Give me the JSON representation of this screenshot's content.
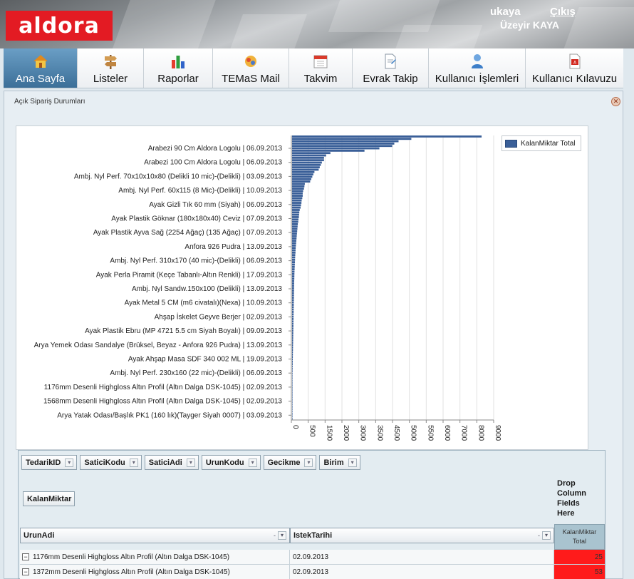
{
  "header": {
    "logo_text": "aldora",
    "username": "ukaya",
    "logout_label": "Çıkış",
    "full_name": "Üzeyir KAYA"
  },
  "nav": {
    "items": [
      {
        "label": "Ana Sayfa",
        "icon": "home-icon",
        "active": true
      },
      {
        "label": "Listeler",
        "icon": "signpost-icon",
        "active": false
      },
      {
        "label": "Raporlar",
        "icon": "bar-chart-icon",
        "active": false
      },
      {
        "label": "TEMaS Mail",
        "icon": "mail-icon",
        "active": false
      },
      {
        "label": "Takvim",
        "icon": "calendar-icon",
        "active": false
      },
      {
        "label": "Evrak Takip",
        "icon": "document-icon",
        "active": false
      },
      {
        "label": "Kullanıcı İşlemleri",
        "icon": "user-icon",
        "active": false
      },
      {
        "label": "Kullanıcı Kılavuzu",
        "icon": "pdf-icon",
        "active": false
      }
    ]
  },
  "panel": {
    "title": "Açık Sipariş Durumları"
  },
  "chart_data": {
    "type": "bar",
    "orientation": "horizontal",
    "legend": {
      "entries": [
        "KalanMiktar Total"
      ],
      "placement": "top-right"
    },
    "series_color": "#3a5f98",
    "x_ticks": [
      "0",
      "500",
      "1500",
      "2000",
      "3000",
      "3500",
      "4500",
      "5000",
      "5500",
      "6000",
      "7000",
      "8000",
      "9000"
    ],
    "xlim": [
      0,
      9500
    ],
    "grid": true,
    "category_labels": [
      "Arabezi 90 Cm Aldora Logolu | 06.09.2013",
      "Arabezi 100 Cm Aldora Logolu | 06.09.2013",
      "Ambj. Nyl Perf. 70x10x10x80 (Delikli 10 mic)-(Delikli) | 03.09.2013",
      "Ambj. Nyl Perf. 60x115 (8 Mic)-(Delikli) | 10.09.2013",
      "Ayak Gizli Tık 60 mm (Siyah) | 06.09.2013",
      "Ayak Plastik Göknar (180x180x40) Ceviz | 07.09.2013",
      "Ayak Plastik Ayva Sağ (2254 Ağaç) (135 Ağaç) | 07.09.2013",
      "Anfora 926 Pudra | 13.09.2013",
      "Ambj. Nyl Perf. 310x170 (40 mic)-(Delikli) | 06.09.2013",
      "Ayak Perla Piramit (Keçe Tabanlı-Altın Renkli) | 17.09.2013",
      "Ambj. Nyl Sandw.150x100 (Delikli) | 13.09.2013",
      "Ayak Metal 5 CM (m6 civatalı)(Nexa) | 10.09.2013",
      "Ahşap İskelet Geyve Berjer | 02.09.2013",
      "Ayak Plastik Ebru (MP 4721 5.5 cm Siyah Boyalı) | 09.09.2013",
      "Arya Yemek Odası Sandalye (Brüksel, Beyaz - Anfora 926 Pudra) | 13.09.2013",
      "Ayak Ahşap Masa SDF 340 002 ML | 19.09.2013",
      "Ambj. Nyl Perf. 230x160 (22 mic)-(Delikli) | 06.09.2013",
      "1176mm Desenli Highgloss Altın Profil (Altın Dalga DSK-1045)  | 02.09.2013",
      "1568mm Desenli Highgloss Altın Profil (Altın Dalga DSK-1045)  | 02.09.2013",
      "Arya Yatak Odası/Başlık PK1 (160 lık)(Tayger Siyah 0007) | 03.09.2013"
    ],
    "values": [
      8900,
      5600,
      5000,
      4800,
      4700,
      4100,
      3400,
      1800,
      1600,
      1500,
      1500,
      1400,
      1350,
      1300,
      1250,
      1050,
      1000,
      950,
      900,
      850,
      600,
      580,
      560,
      520,
      500,
      500,
      480,
      450,
      440,
      420,
      400,
      360,
      340,
      330,
      320,
      300,
      290,
      270,
      260,
      250,
      240,
      230,
      220,
      210,
      200,
      190,
      180,
      170,
      165,
      160,
      150,
      145,
      140,
      135,
      130,
      125,
      120,
      115,
      110,
      108,
      105,
      100,
      98,
      96,
      94,
      92,
      90,
      88,
      86,
      84,
      82,
      80,
      78,
      76,
      74,
      72,
      70,
      68,
      66,
      64,
      62,
      60,
      58,
      56,
      54,
      52,
      50,
      48,
      46,
      44,
      42,
      40,
      38,
      36,
      34,
      32,
      30,
      28,
      26,
      24,
      22,
      20,
      18,
      16,
      14,
      12,
      10,
      9,
      8,
      7,
      6,
      5,
      5,
      4,
      4,
      3,
      3,
      2,
      2,
      1
    ]
  },
  "pivot": {
    "filter_fields": [
      "TedarikID",
      "SaticiKodu",
      "SaticiAdi",
      "UrunKodu",
      "Gecikme",
      "Birim"
    ],
    "data_field": "KalanMiktar",
    "drop_hint_lines": [
      "Drop",
      "Column",
      "Fields",
      "Here"
    ],
    "row_fields": [
      {
        "label": "UrunAdi",
        "sort": "-"
      },
      {
        "label": "IstekTarihi",
        "sort": "-"
      }
    ],
    "value_header_lines": [
      "KalanMiktar",
      "Total"
    ],
    "rows": [
      {
        "name": "1176mm Desenli Highgloss Altın Profil (Altın Dalga DSK-1045)",
        "date": "02.09.2013",
        "value": "25"
      },
      {
        "name": "1372mm Desenli Highgloss Altın Profil (Altın Dalga DSK-1045)",
        "date": "02.09.2013",
        "value": "53"
      }
    ]
  }
}
